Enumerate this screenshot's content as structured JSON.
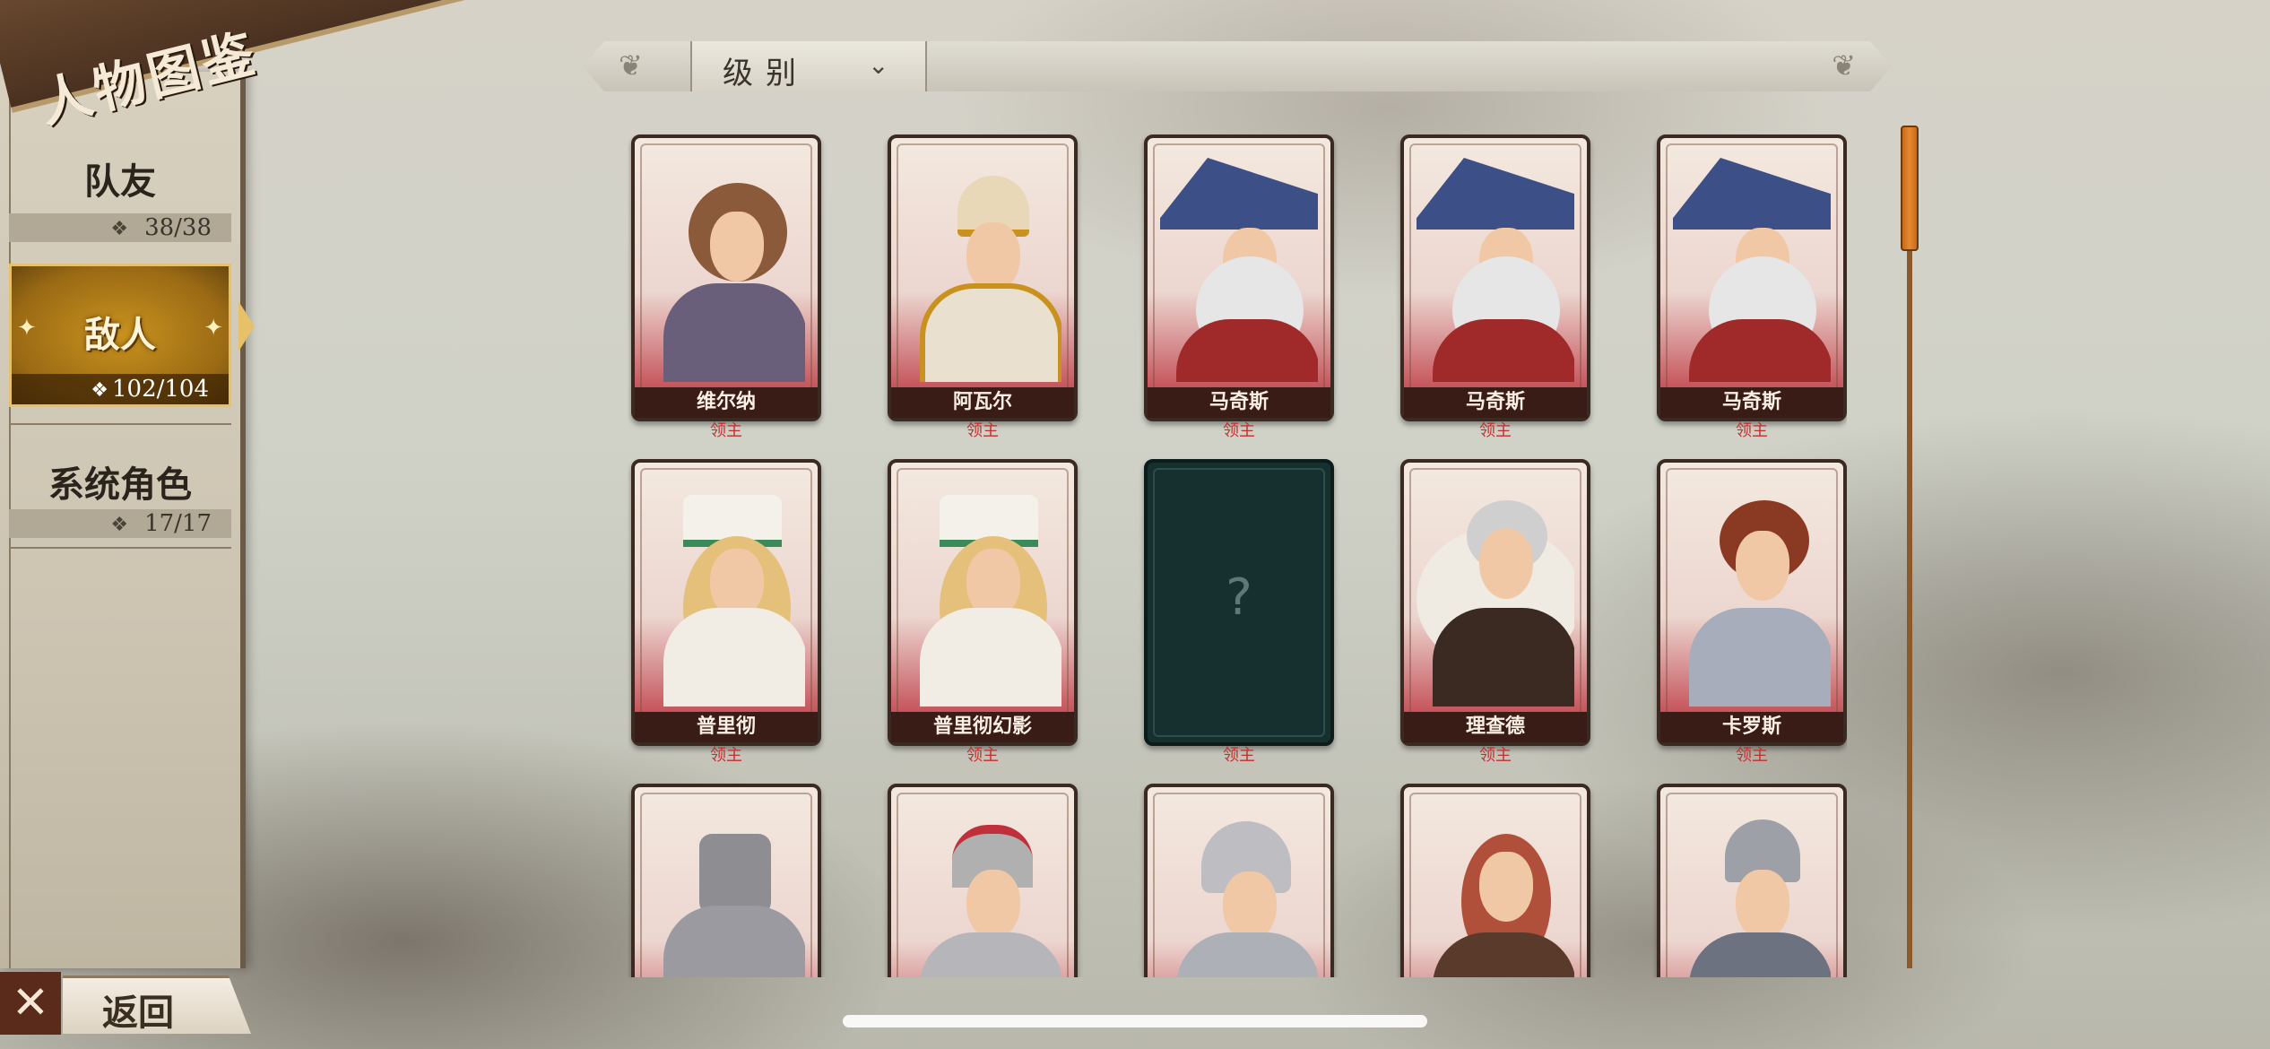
{
  "header": {
    "title": "人物图鉴"
  },
  "sidebar": {
    "items": [
      {
        "label": "队友",
        "count": "38/38",
        "active": false
      },
      {
        "label": "敌人",
        "count": "102/104",
        "active": true
      },
      {
        "label": "系统角色",
        "count": "17/17",
        "active": false
      }
    ]
  },
  "filter": {
    "label": "级别",
    "chevron": "⌄"
  },
  "cards": [
    {
      "name": "维尔纳",
      "role": "领主"
    },
    {
      "name": "阿瓦尔",
      "role": "领主"
    },
    {
      "name": "马奇斯",
      "role": "领主"
    },
    {
      "name": "马奇斯",
      "role": "领主"
    },
    {
      "name": "马奇斯",
      "role": "领主"
    },
    {
      "name": "普里彻",
      "role": "领主"
    },
    {
      "name": "普里彻幻影",
      "role": "领主"
    },
    {
      "name": "",
      "role": "领主",
      "locked_mark": "?"
    },
    {
      "name": "理查德",
      "role": "领主"
    },
    {
      "name": "卡罗斯",
      "role": "领主"
    },
    {
      "name": "",
      "role": ""
    },
    {
      "name": "",
      "role": ""
    },
    {
      "name": "",
      "role": ""
    },
    {
      "name": "",
      "role": ""
    },
    {
      "name": "",
      "role": ""
    }
  ],
  "footer": {
    "back_label": "返回",
    "close_icon": "✕"
  },
  "colors": {
    "accent": "#c9921e",
    "role_text": "#c03030",
    "card_frame": "#3a1c16",
    "scroll": "#e8892e"
  }
}
